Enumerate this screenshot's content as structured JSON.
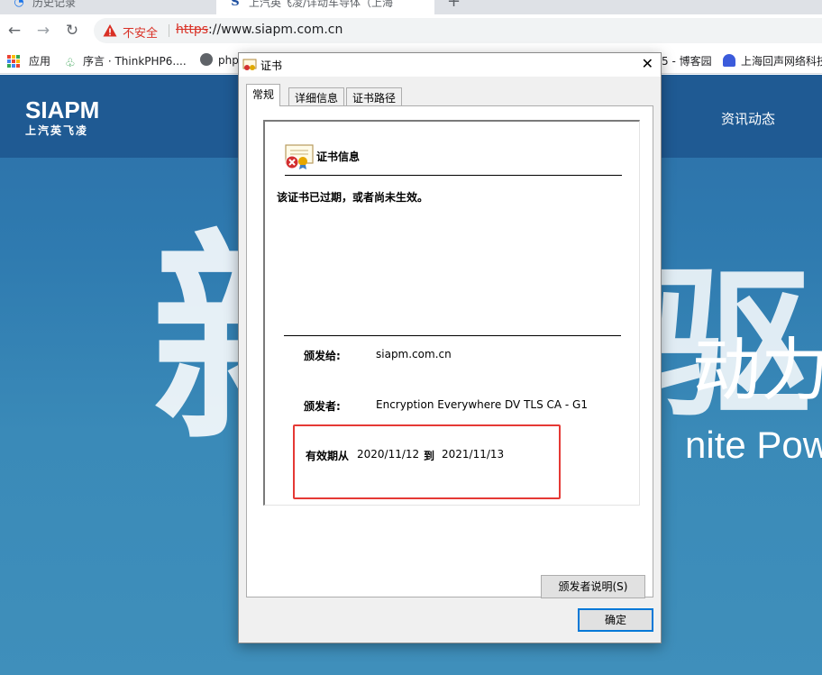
{
  "browser": {
    "tabs": [
      {
        "label": "历史记录"
      },
      {
        "label": "上汽英飞凌/详动车导体（上海"
      }
    ],
    "new_tab_label": "+",
    "security_label": "不安全",
    "url_scheme": "https",
    "url_rest": "://www.siapm.com.cn",
    "bookmarks": [
      {
        "label": "应用"
      },
      {
        "label": "序言 · ThinkPHP6...."
      },
      {
        "label": "php"
      },
      {
        "label": "5 - 博客园"
      },
      {
        "label": "上海回声网络科技"
      }
    ],
    "icons": {
      "back": "back-arrow-icon",
      "forward": "forward-arrow-icon",
      "reload": "reload-icon",
      "warning": "warning-triangle-icon"
    },
    "colors": {
      "insecure": "#d93025",
      "tab_strip": "#dee1e6"
    }
  },
  "site": {
    "logo": "SIAPM",
    "logo_sub": "上汽英飞凌",
    "nav_news": "资讯动态",
    "hero_glyph_left": "新",
    "hero_glyph_right": "驱",
    "hero_big_text": "动力",
    "hero_sub_text": "nite Pow",
    "colors": {
      "header": "#1f5a93",
      "hero": "#2f7bb0"
    }
  },
  "dialog": {
    "title": "证书",
    "close_glyph": "✕",
    "tabs": [
      "常规",
      "详细信息",
      "证书路径"
    ],
    "active_tab": "常规",
    "info_title": "证书信息",
    "status_message": "该证书已过期，或者尚未生效。",
    "issued_to_label": "颁发给:",
    "issued_to_value": "siapm.com.cn",
    "issued_by_label": "颁发者:",
    "issued_by_value": "Encryption Everywhere DV TLS CA - G1",
    "valid_from_label": "有效期从",
    "valid_from_value": "2020/11/12",
    "valid_to_label": "到",
    "valid_to_value": "2021/11/13",
    "issuer_statement_button": "颁发者说明(S)",
    "ok_button": "确定",
    "colors": {
      "highlight_box": "#e53935",
      "default_button_border": "#0078d7"
    }
  }
}
